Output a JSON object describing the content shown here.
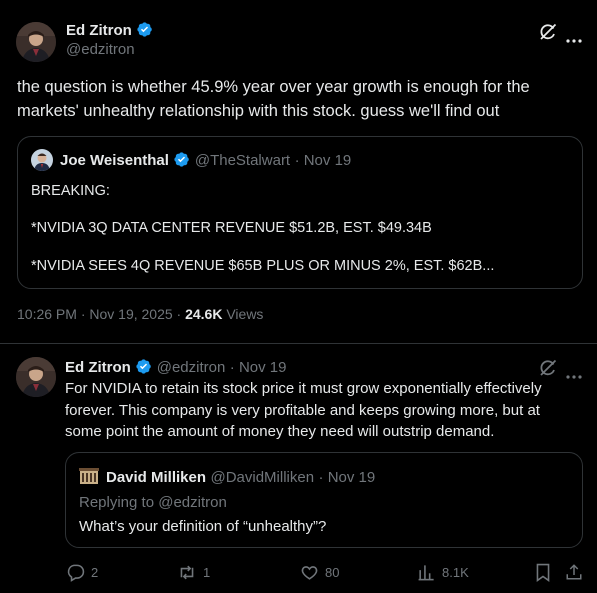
{
  "main_tweet": {
    "author_name": "Ed Zitron",
    "author_handle": "@edzitron",
    "text": "the question is whether 45.9% year over year growth is enough for the markets' unhealthy relationship with this stock. guess we'll find out",
    "quoted": {
      "author_name": "Joe Weisenthal",
      "author_handle": "@TheStalwart",
      "date": "· Nov 19",
      "lines": [
        "BREAKING:",
        "*NVIDIA 3Q DATA CENTER REVENUE $51.2B, EST. $49.34B",
        "*NVIDIA SEES 4Q REVENUE $65B PLUS OR MINUS 2%, EST. $62B..."
      ]
    },
    "timestamp": "10:26 PM · Nov 19, 2025 · ",
    "views_count": "24.6K",
    "views_label": " Views"
  },
  "reply_tweet": {
    "author_name": "Ed Zitron",
    "author_handle": "@edzitron",
    "date": "· Nov 19",
    "text": "For NVIDIA to retain its stock price it must grow exponentially effectively forever. This company is very profitable and keeps growing more, but at some point the amount of money they need will outstrip demand.",
    "quoted": {
      "author_name": "David Milliken",
      "author_handle": "@DavidMilliken",
      "date": "· Nov 19",
      "replying_to": "Replying to @edzitron",
      "text": "What’s your definition of “unhealthy”?"
    },
    "actions": {
      "replies": "2",
      "reposts": "1",
      "likes": "80",
      "views": "8.1K"
    }
  },
  "colors": {
    "background": "#000000",
    "text": "#e7e9ea",
    "secondary": "#71767b",
    "border": "#2f3336",
    "verified": "#1d9bf0"
  },
  "icons": [
    "grok-icon",
    "more-icon",
    "verified-icon",
    "reply-icon",
    "repost-icon",
    "like-icon",
    "views-icon",
    "bookmark-icon",
    "share-icon"
  ]
}
